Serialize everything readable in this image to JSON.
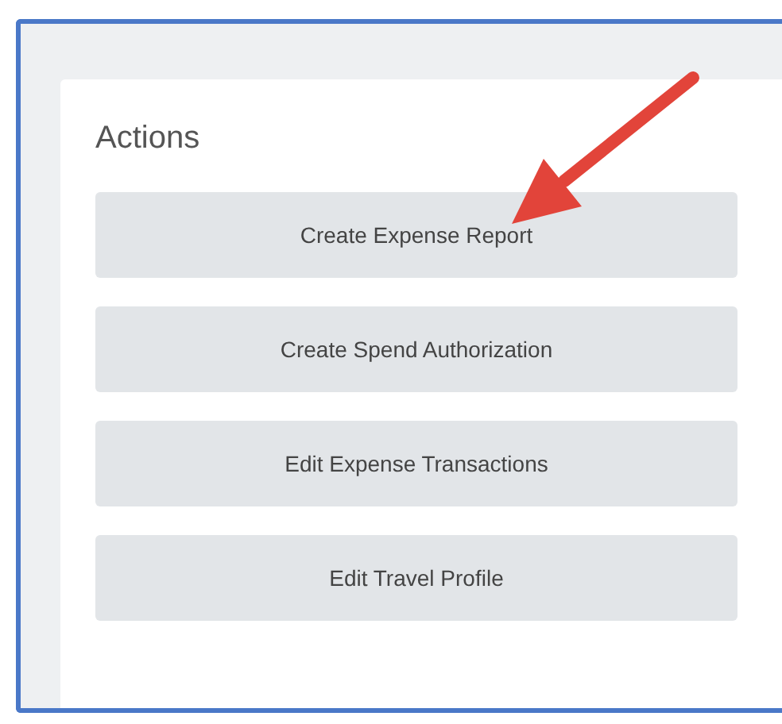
{
  "panel": {
    "title": "Actions"
  },
  "buttons": [
    {
      "label": "Create Expense Report"
    },
    {
      "label": "Create Spend Authorization"
    },
    {
      "label": "Edit Expense Transactions"
    },
    {
      "label": "Edit Travel Profile"
    }
  ]
}
